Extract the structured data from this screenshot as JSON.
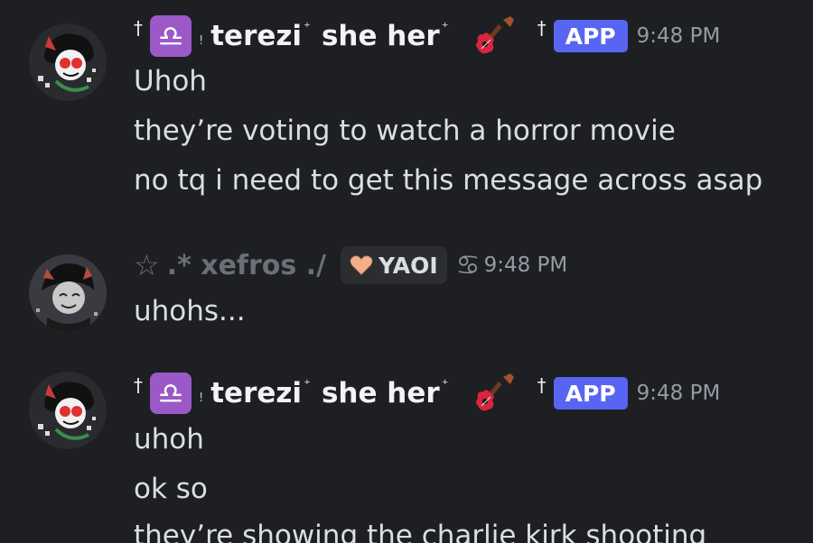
{
  "messages": [
    {
      "author_prefix": "†",
      "zodiac": "♎",
      "separator": "!",
      "name": "terezi",
      "name_mark": "⁺",
      "pronouns": "she her",
      "pronouns_mark": "⁺",
      "guitar_icon": "guitar-emoji-icon",
      "mid_mark": "†",
      "badge": "APP",
      "time": "9:48 PM",
      "lines": [
        "Uhoh",
        "they’re voting to watch a horror movie",
        "no tq i need to get this message across asap"
      ]
    },
    {
      "star": "☆",
      "name": ".* xefros ./",
      "tag": "YAOI",
      "zodiac_icon": "♋",
      "time": "9:48 PM",
      "lines": [
        "uhohs..."
      ]
    },
    {
      "author_prefix": "†",
      "zodiac": "♎",
      "separator": "!",
      "name": "terezi",
      "name_mark": "⁺",
      "pronouns": "she her",
      "pronouns_mark": "⁺",
      "guitar_icon": "guitar-emoji-icon",
      "mid_mark": "†",
      "badge": "APP",
      "time": "9:48 PM",
      "lines": [
        "uhoh",
        "ok so",
        "they’re showing the charlie kirk shooting"
      ]
    }
  ],
  "colors": {
    "background": "#1e1f22",
    "text": "#dbdee1",
    "app_badge": "#5865f2",
    "zodiac_tile": "#9b59c8",
    "muted": "#949ba4"
  }
}
